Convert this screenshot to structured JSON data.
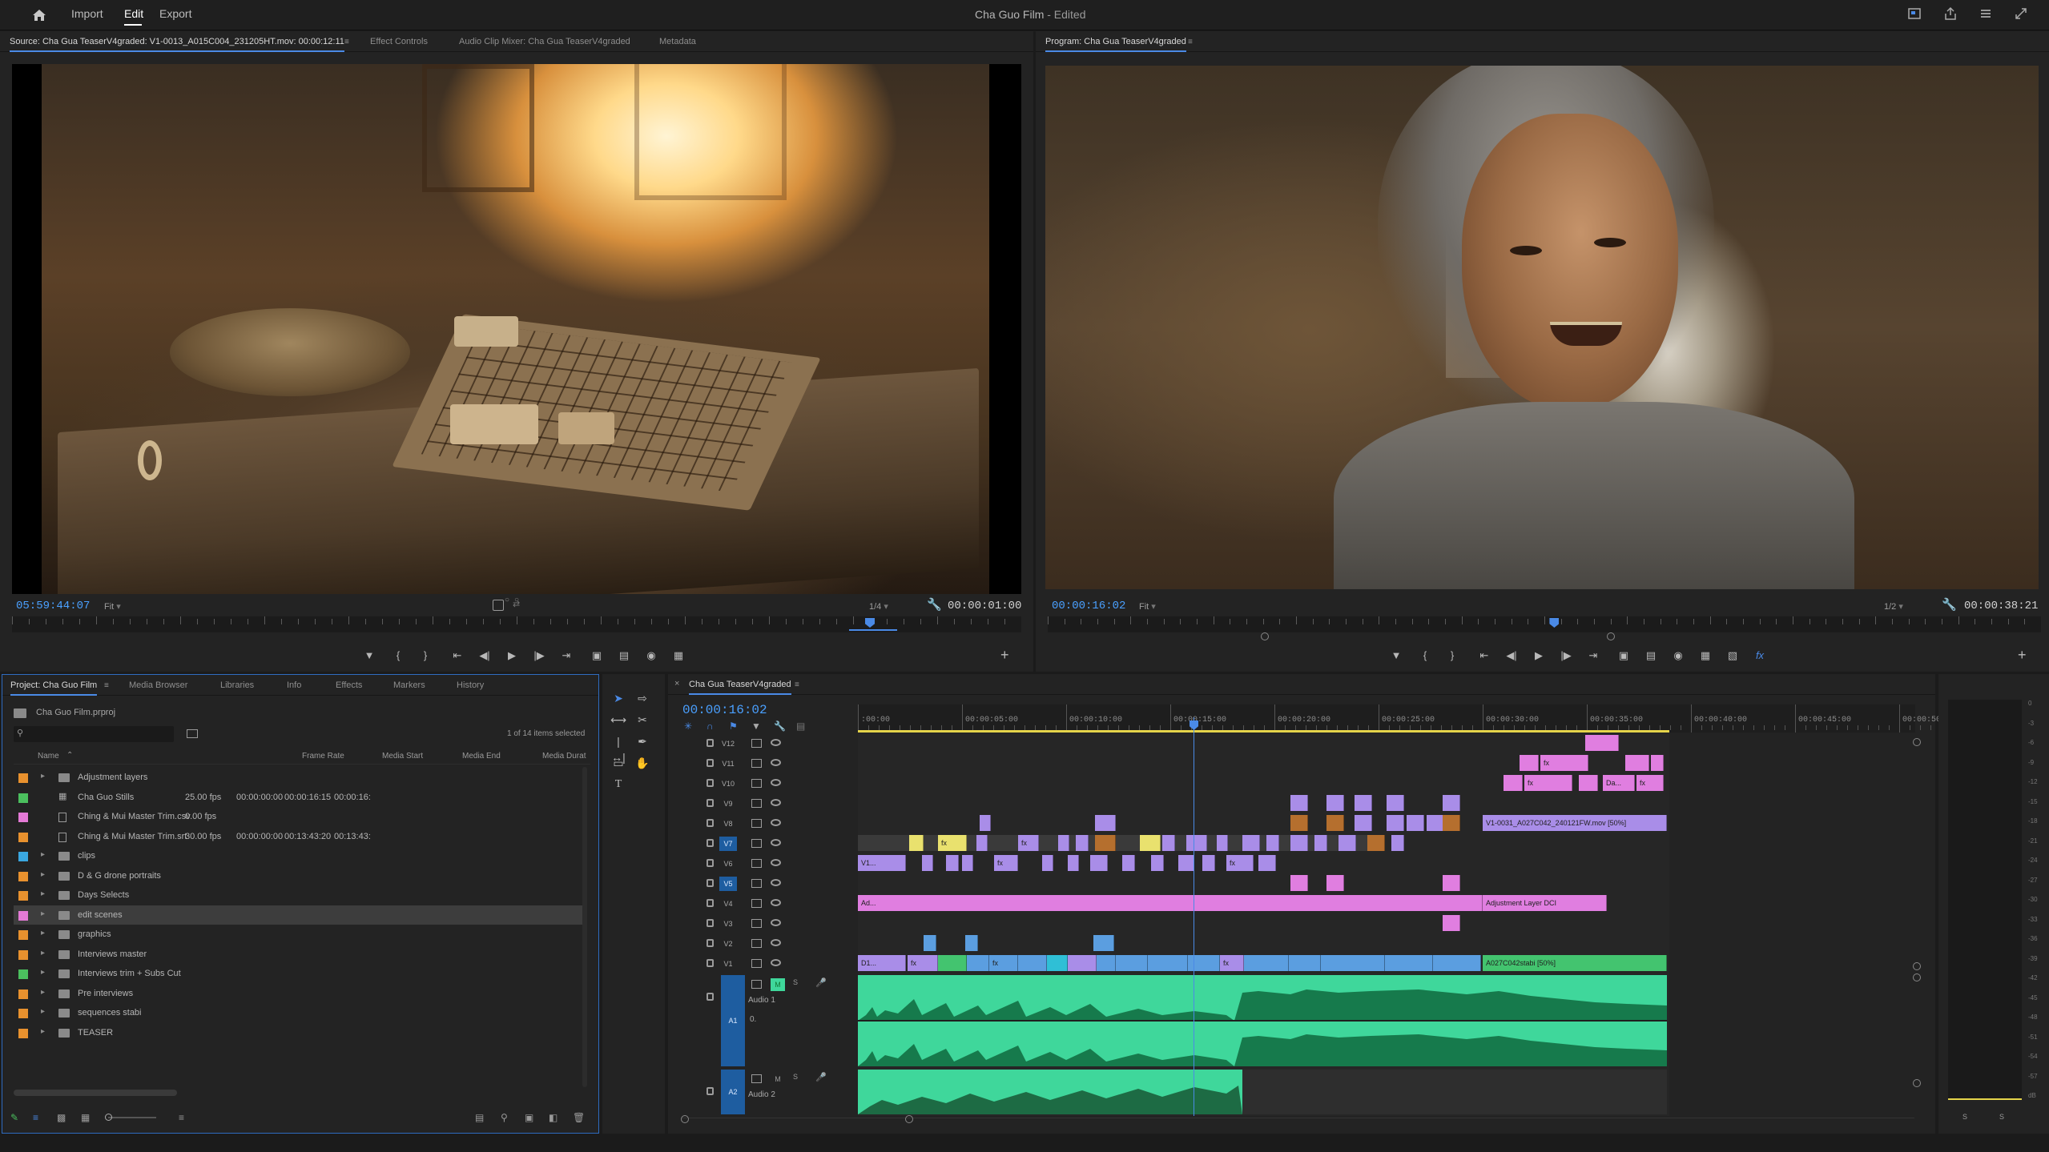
{
  "topbar": {
    "home_icon": "home-icon",
    "menu": [
      "Import",
      "Edit",
      "Export"
    ],
    "active_menu": "Edit",
    "project_title": "Cha Guo Film",
    "edited_suffix": " - Edited",
    "right_icons": [
      "quick-export-icon",
      "share-icon",
      "workspaces-menu-icon",
      "fullscreen-icon"
    ]
  },
  "source_monitor": {
    "tabs": [
      "Source: Cha Gua TeaserV4graded: V1-0013_A015C004_231205HT.mov: 00:00:12:11",
      "Effect Controls",
      "Audio Clip Mixer: Cha Gua TeaserV4graded",
      "Metadata"
    ],
    "timecode": "05:59:44:07",
    "fit": "Fit",
    "resolution": "1/4",
    "duration": "00:00:01:00",
    "playhead_fraction": 0.85
  },
  "program_monitor": {
    "tab": "Program: Cha Gua TeaserV4graded",
    "timecode": "00:00:16:02",
    "fit": "Fit",
    "resolution": "1/2",
    "duration": "00:00:38:21",
    "playhead_fraction": 0.51
  },
  "project_panel": {
    "tabs": [
      "Project: Cha Guo Film",
      "Media Browser",
      "Libraries",
      "Info",
      "Effects",
      "Markers",
      "History"
    ],
    "project_file": "Cha Guo Film.prproj",
    "search_placeholder": "",
    "selection_count": "1 of 14 items selected",
    "columns": [
      "Name",
      "Frame Rate",
      "Media Start",
      "Media End",
      "Media Durat"
    ],
    "rows": [
      {
        "name": "Adjustment layers",
        "color": "#e8912e",
        "type": "folder",
        "fps": "",
        "start": "",
        "end": "",
        "dur": ""
      },
      {
        "name": "Cha Guo Stills",
        "color": "#4bbf5e",
        "type": "sequence",
        "fps": "25.00 fps",
        "start": "00:00:00:00",
        "end": "00:00:16:15",
        "dur": "00:00:16:"
      },
      {
        "name": "Ching & Mui Master Trim.csv",
        "color": "#e47ad6",
        "type": "file",
        "fps": "0.00 fps",
        "start": "",
        "end": "",
        "dur": ""
      },
      {
        "name": "Ching & Mui Master Trim.srt",
        "color": "#e8912e",
        "type": "file",
        "fps": "30.00 fps",
        "start": "00:00:00:00",
        "end": "00:13:43:20",
        "dur": "00:13:43:"
      },
      {
        "name": "clips",
        "color": "#3aa7e0",
        "type": "folder",
        "fps": "",
        "start": "",
        "end": "",
        "dur": ""
      },
      {
        "name": "D & G drone portraits",
        "color": "#e8912e",
        "type": "folder",
        "fps": "",
        "start": "",
        "end": "",
        "dur": ""
      },
      {
        "name": "Days Selects",
        "color": "#e8912e",
        "type": "folder",
        "fps": "",
        "start": "",
        "end": "",
        "dur": ""
      },
      {
        "name": "edit scenes",
        "color": "#e47ad6",
        "type": "folder",
        "fps": "",
        "start": "",
        "end": "",
        "dur": "",
        "selected": true
      },
      {
        "name": "graphics",
        "color": "#e8912e",
        "type": "folder",
        "fps": "",
        "start": "",
        "end": "",
        "dur": ""
      },
      {
        "name": "Interviews master",
        "color": "#e8912e",
        "type": "folder",
        "fps": "",
        "start": "",
        "end": "",
        "dur": ""
      },
      {
        "name": "Interviews trim + Subs Cut",
        "color": "#4bbf5e",
        "type": "folder",
        "fps": "",
        "start": "",
        "end": "",
        "dur": ""
      },
      {
        "name": "Pre interviews",
        "color": "#e8912e",
        "type": "folder",
        "fps": "",
        "start": "",
        "end": "",
        "dur": ""
      },
      {
        "name": "sequences stabi",
        "color": "#e8912e",
        "type": "folder",
        "fps": "",
        "start": "",
        "end": "",
        "dur": ""
      },
      {
        "name": "TEASER",
        "color": "#e8912e",
        "type": "folder",
        "fps": "",
        "start": "",
        "end": "",
        "dur": ""
      }
    ]
  },
  "timeline": {
    "sequence_tab": "Cha Gua TeaserV4graded",
    "timecode": "00:00:16:02",
    "ruler_ticks": [
      ":00:00",
      "00:00:05:00",
      "00:00:10:00",
      "00:00:15:00",
      "00:00:20:00",
      "00:00:25:00",
      "00:00:30:00",
      "00:00:35:00",
      "00:00:40:00",
      "00:00:45:00",
      "00:00:50"
    ],
    "video_tracks": [
      "V12",
      "V11",
      "V10",
      "V9",
      "V8",
      "V7",
      "V6",
      "V5",
      "V4",
      "V3",
      "V2",
      "V1"
    ],
    "active_tracks": [
      "V7",
      "V5"
    ],
    "audio_tracks": [
      {
        "id": "A1",
        "name": "Audio 1",
        "mute": "M",
        "solo": "S",
        "volume": "0."
      },
      {
        "id": "A2",
        "name": "Audio 2",
        "mute": "M",
        "solo": "S"
      }
    ],
    "clip_labels": {
      "v8_long": "V1-0031_A027C042_240121FW.mov [50%]",
      "v4_adj": "Adjustment Layer DCI",
      "v4_start": "Ad...",
      "v6_start": "V1...",
      "v1_start": "D1...",
      "v1_end": "A027C042stabi [50%]",
      "v10_da": "Da...",
      "fx": "fx"
    },
    "colors": {
      "violet": "#a98de8",
      "pink": "#e07ee0",
      "green": "#43c46f",
      "yellow": "#e9e16e",
      "brown": "#b56f2e",
      "blue": "#5b9ee0",
      "cyan": "#2fbfd6",
      "audio": "#3fd79b"
    },
    "meter_scale": [
      "0",
      "-3",
      "-6",
      "-9",
      "-12",
      "-15",
      "-18",
      "-21",
      "-24",
      "-27",
      "-30",
      "-33",
      "-36",
      "-39",
      "-42",
      "-45",
      "-48",
      "-51",
      "-54",
      "-57",
      "dB"
    ],
    "meter_solo": [
      "S",
      "S"
    ]
  }
}
